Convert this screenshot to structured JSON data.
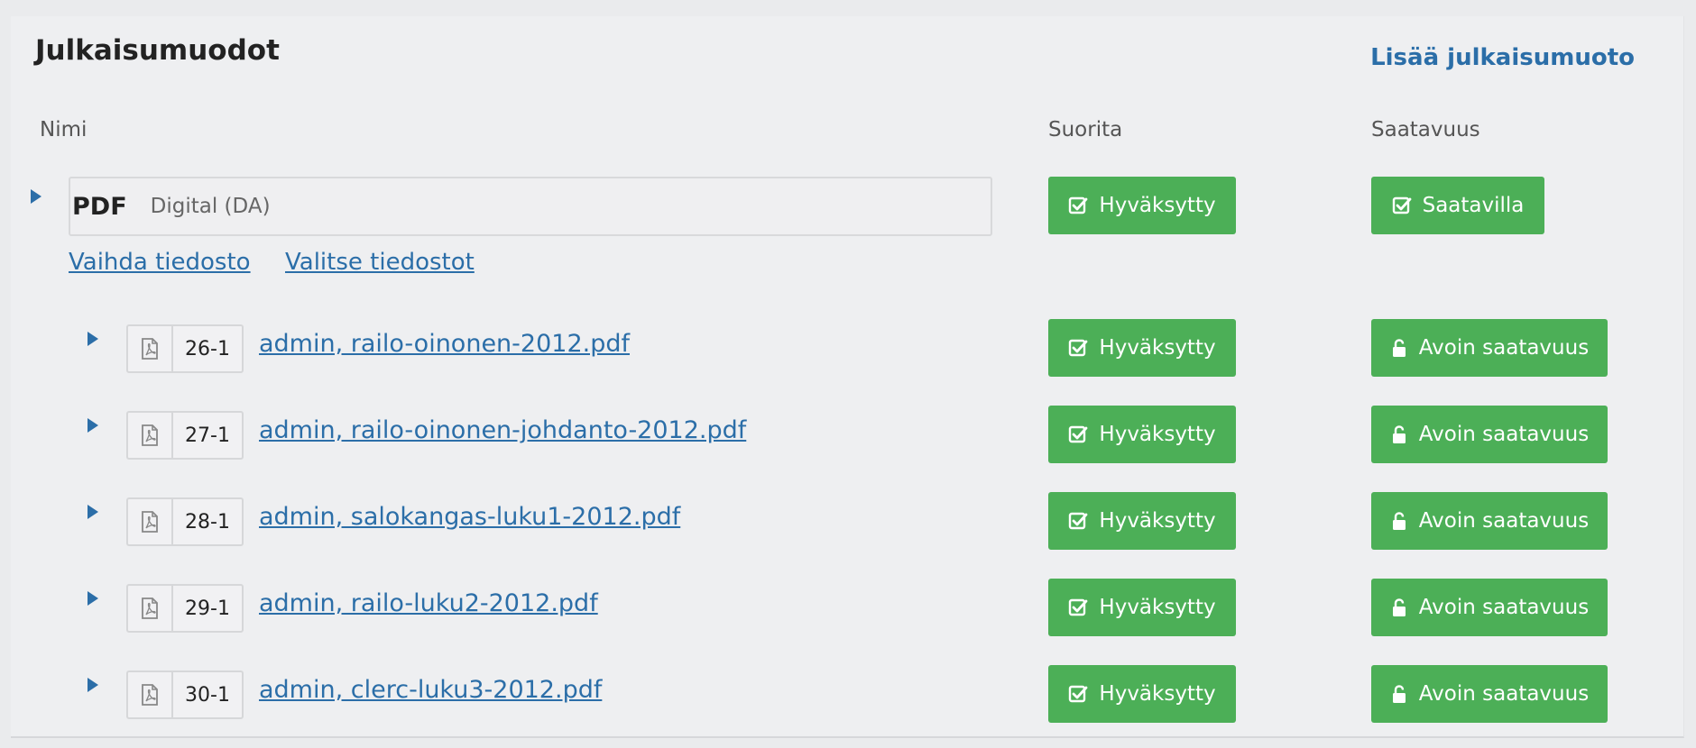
{
  "header": {
    "title": "Julkaisumuodot",
    "add_link": "Lisää julkaisumuoto"
  },
  "columns": {
    "name": "Nimi",
    "run": "Suorita",
    "availability": "Saatavuus"
  },
  "format": {
    "name": "PDF",
    "type": "Digital (DA)",
    "run_label": "Hyväksytty",
    "availability_label": "Saatavilla",
    "change_file": "Vaihda tiedosto",
    "select_files": "Valitse tiedostot"
  },
  "files": [
    {
      "id": "26-1",
      "name": "admin, railo-oinonen-2012.pdf",
      "run_label": "Hyväksytty",
      "availability_label": "Avoin saatavuus"
    },
    {
      "id": "27-1",
      "name": "admin, railo-oinonen-johdanto-2012.pdf",
      "run_label": "Hyväksytty",
      "availability_label": "Avoin saatavuus"
    },
    {
      "id": "28-1",
      "name": "admin, salokangas-luku1-2012.pdf",
      "run_label": "Hyväksytty",
      "availability_label": "Avoin saatavuus"
    },
    {
      "id": "29-1",
      "name": "admin, railo-luku2-2012.pdf",
      "run_label": "Hyväksytty",
      "availability_label": "Avoin saatavuus"
    },
    {
      "id": "30-1",
      "name": "admin, clerc-luku3-2012.pdf",
      "run_label": "Hyväksytty",
      "availability_label": "Avoin saatavuus"
    }
  ],
  "colors": {
    "accent": "#2b6ea8",
    "success": "#4caf57",
    "background": "#eeeff1"
  },
  "icons": {
    "approved": "check-square-icon",
    "available": "check-square-icon",
    "open_access": "unlock-icon",
    "file": "pdf-file-icon",
    "expander": "caret-right-icon"
  }
}
